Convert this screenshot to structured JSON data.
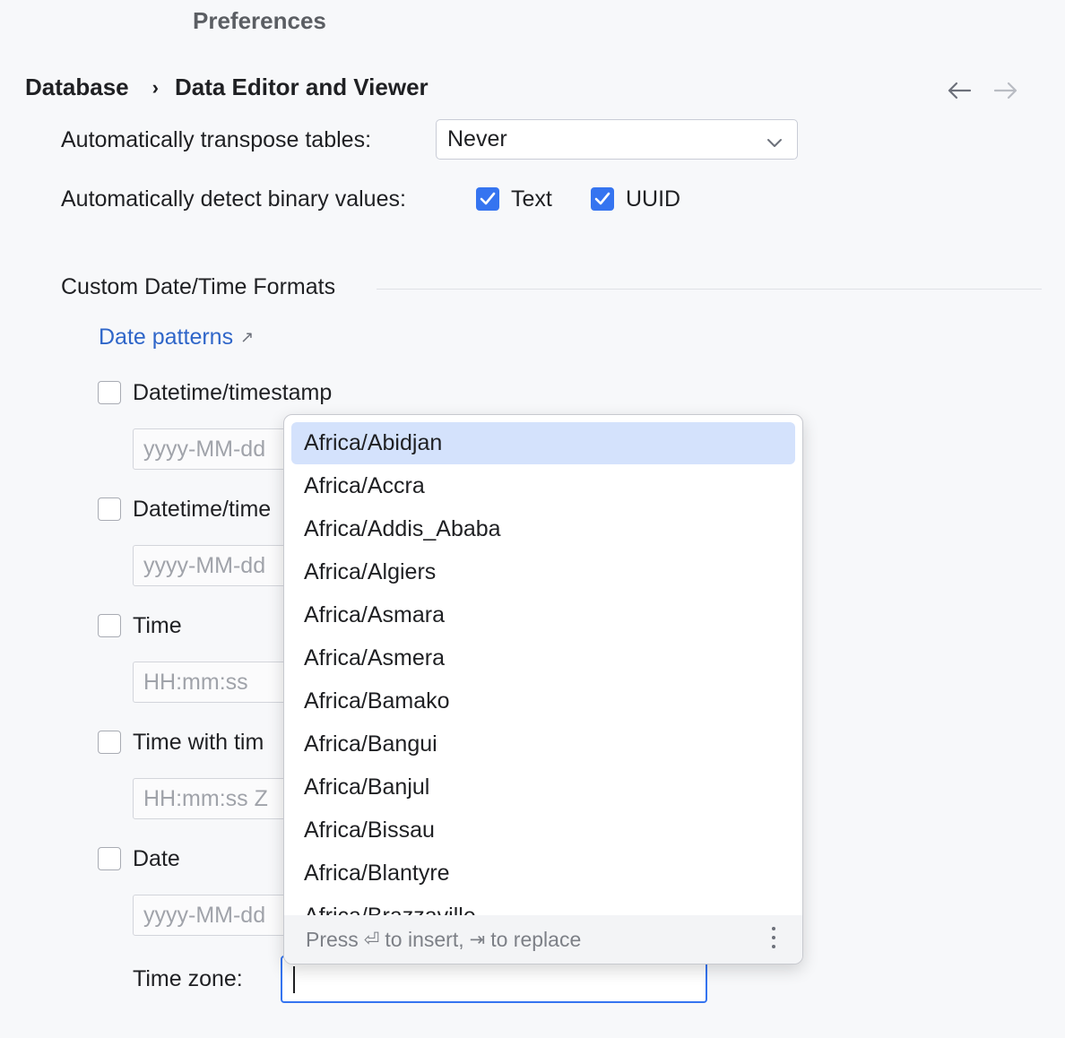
{
  "window": {
    "title": "Preferences"
  },
  "breadcrumb": {
    "parent": "Database",
    "separator": "›",
    "current": "Data Editor and Viewer"
  },
  "transpose": {
    "label": "Automatically transpose tables:",
    "value": "Never"
  },
  "binary": {
    "label": "Automatically detect binary values:",
    "text_label": "Text",
    "text_checked": true,
    "uuid_label": "UUID",
    "uuid_checked": true
  },
  "section": {
    "title": "Custom Date/Time Formats",
    "link": "Date patterns",
    "link_icon": "↗"
  },
  "formats": [
    {
      "label": "Datetime/timestamp",
      "checked": false,
      "placeholder": "yyyy-MM-dd"
    },
    {
      "label": "Datetime/time",
      "checked": false,
      "placeholder": "yyyy-MM-dd"
    },
    {
      "label": "Time",
      "checked": false,
      "placeholder": "HH:mm:ss"
    },
    {
      "label": "Time with tim",
      "checked": false,
      "placeholder": "HH:mm:ss Z"
    },
    {
      "label": "Date",
      "checked": false,
      "placeholder": "yyyy-MM-dd"
    }
  ],
  "timezone": {
    "label": "Time zone:",
    "value": ""
  },
  "popup": {
    "items": [
      "Africa/Abidjan",
      "Africa/Accra",
      "Africa/Addis_Ababa",
      "Africa/Algiers",
      "Africa/Asmara",
      "Africa/Asmera",
      "Africa/Bamako",
      "Africa/Bangui",
      "Africa/Banjul",
      "Africa/Bissau",
      "Africa/Blantyre",
      "Africa/Brazzaville"
    ],
    "selected_index": 0,
    "footer": {
      "press": "Press",
      "insert_key": "⏎",
      "insert": "to insert,",
      "replace_key": "⇥",
      "replace": "to replace"
    }
  },
  "colors": {
    "accent": "#3574f0",
    "link": "#2f66c9",
    "selection": "#d4e2fc",
    "background": "#f7f8fa"
  }
}
